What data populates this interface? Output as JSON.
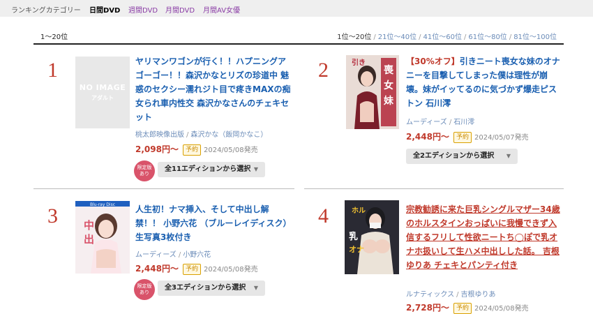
{
  "topbar": {
    "category_label": "ランキングカテゴリー",
    "nav": [
      "日間DVD",
      "週間DVD",
      "月間DVD",
      "月間AV女優"
    ]
  },
  "range": "1〜20位",
  "pager": {
    "current": "1位〜20位",
    "links": [
      "21位〜40位",
      "41位〜60位",
      "61位〜80位",
      "81位〜100位"
    ]
  },
  "items": [
    {
      "rank": "1",
      "image": "NO IMAGE",
      "image_sub": "アダルト",
      "title": "ヤリマンワゴンが行く！！ハプニングア ゴーゴー！！森沢かなとリズの珍道中 魅惑のセクシー濡れジト目で疼きMAXの痴女られ車内性交 森沢かなさんのチェキセット",
      "maker": "桃太郎映像出版",
      "actress": "森沢かな（飯岡かなこ）",
      "price": "2,098円〜",
      "badge": "予約",
      "date": "2024/05/08発売",
      "limited": [
        "限定版",
        "あり"
      ],
      "select": "全11エディションから選択"
    },
    {
      "rank": "2",
      "sale": "【30%オフ】",
      "title": "引きニート喪女な妹のオナニーを目撃してしまった僕は理性が崩壊。妹がイッてるのに気づかず爆走ピストン 石川澪",
      "maker": "ムーディーズ",
      "actress": "石川澪",
      "price": "2,448円〜",
      "badge": "予約",
      "date": "2024/05/07発売",
      "select": "全2エディションから選択"
    },
    {
      "rank": "3",
      "title": "人生初！ナマ挿入、そして中出し解禁！！ 小野六花 （ブルーレイディスク） 生写真3枚付き",
      "maker": "ムーディーズ",
      "actress": "小野六花",
      "price": "2,448円〜",
      "badge": "予約",
      "date": "2024/05/08発売",
      "limited": [
        "限定版",
        "あり"
      ],
      "select": "全3エディションから選択"
    },
    {
      "rank": "4",
      "title": "宗教勧誘に来た巨乳シングルマザー34歳のホルスタインおっぱいに我慢できず入信するフリして性欲ニートち◯ぽで乳オナホ扱いして生ハメ中出しした話。 吉根ゆりあ チェキとパンティ付き",
      "maker": "ルナティックス",
      "actress": "吉根ゆりあ",
      "price": "2,728円〜",
      "badge": "予約",
      "date": "2024/05/08発売"
    }
  ],
  "colors": {
    "accent_red": "#c0392b",
    "link_blue": "#1a5fb0",
    "nav_purple": "#8a3ca5",
    "badge_gold": "#d9a000"
  }
}
